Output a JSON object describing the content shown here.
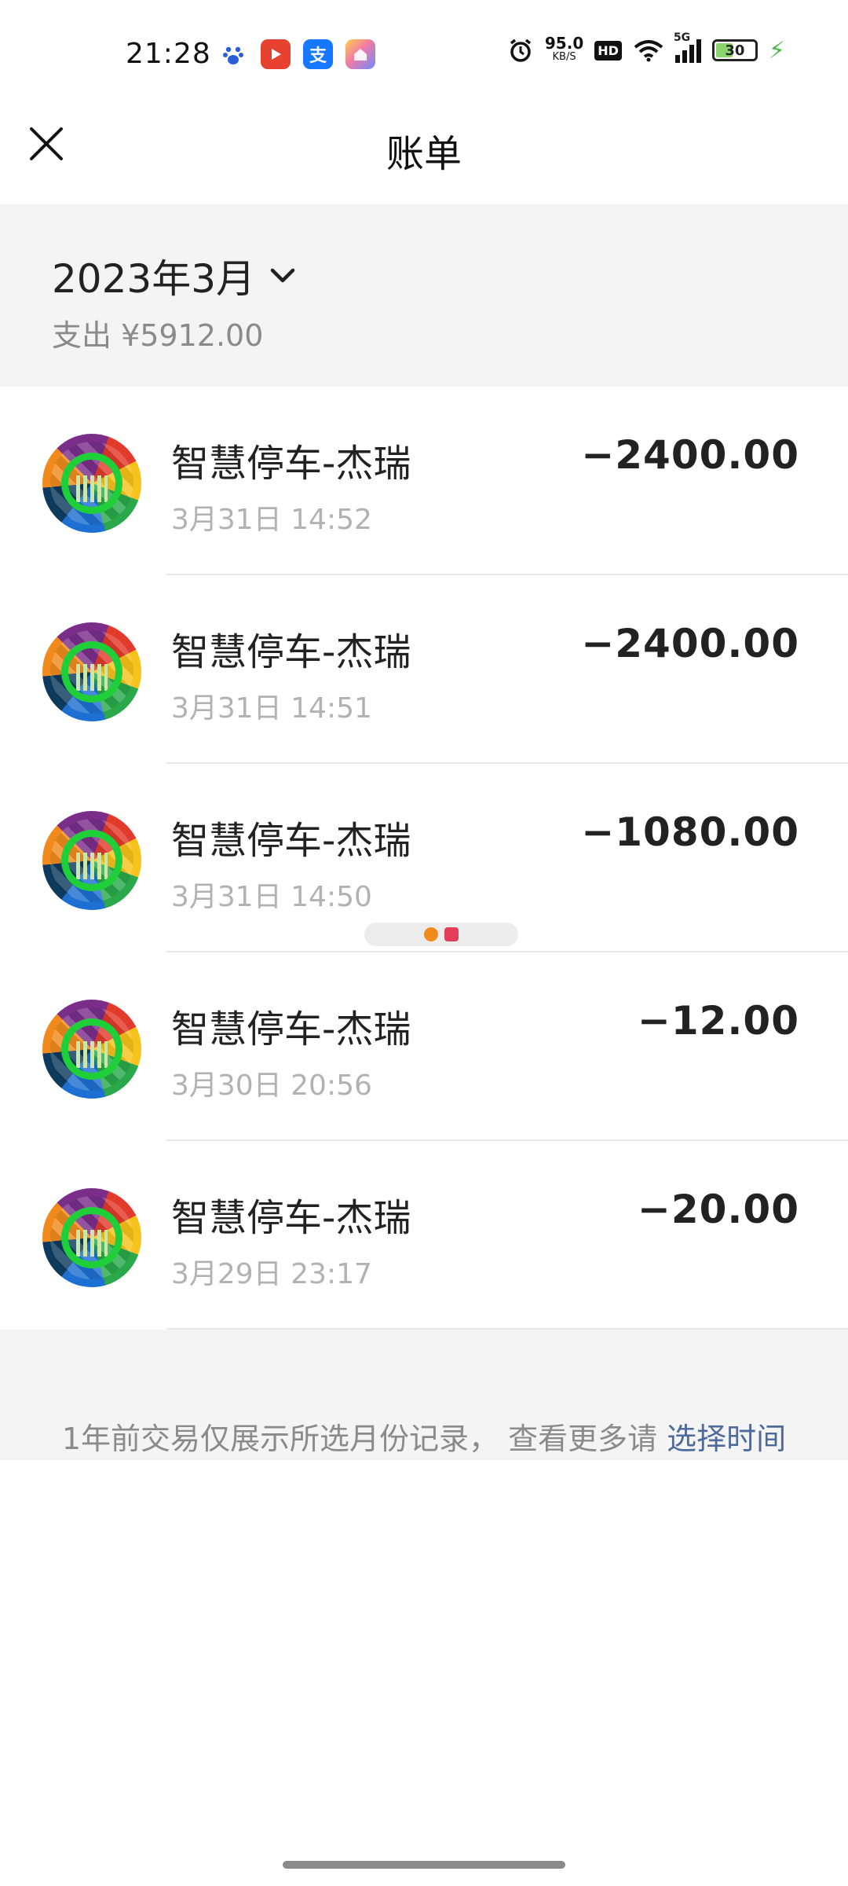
{
  "status_bar": {
    "time": "21:28",
    "apps": [
      "baidu-icon",
      "video-icon",
      "alipay-icon",
      "home-icon"
    ],
    "alipay_glyph": "支",
    "network_speed": "95.0",
    "network_unit": "KB/S",
    "hd": "HD",
    "network_type": "5G",
    "battery": "30"
  },
  "header": {
    "title": "账单"
  },
  "summary": {
    "month": "2023年3月",
    "expense": "支出 ¥5912.00"
  },
  "transactions": [
    {
      "merchant": "智慧停车-杰瑞",
      "datetime": "3月31日 14:52",
      "amount": "−2400.00"
    },
    {
      "merchant": "智慧停车-杰瑞",
      "datetime": "3月31日 14:51",
      "amount": "−2400.00"
    },
    {
      "merchant": "智慧停车-杰瑞",
      "datetime": "3月31日 14:50",
      "amount": "−1080.00"
    },
    {
      "merchant": "智慧停车-杰瑞",
      "datetime": "3月30日 20:56",
      "amount": "−12.00"
    },
    {
      "merchant": "智慧停车-杰瑞",
      "datetime": "3月29日 23:17",
      "amount": "−20.00"
    }
  ],
  "footer": {
    "note": "1年前交易仅展示所选月份记录， 查看更多请 ",
    "link": "选择时间"
  },
  "colors": {
    "background": "#ffffff",
    "section_gray": "#f4f4f4",
    "link": "#4d6a9a",
    "avatar_ring": "#1fcf3a"
  }
}
